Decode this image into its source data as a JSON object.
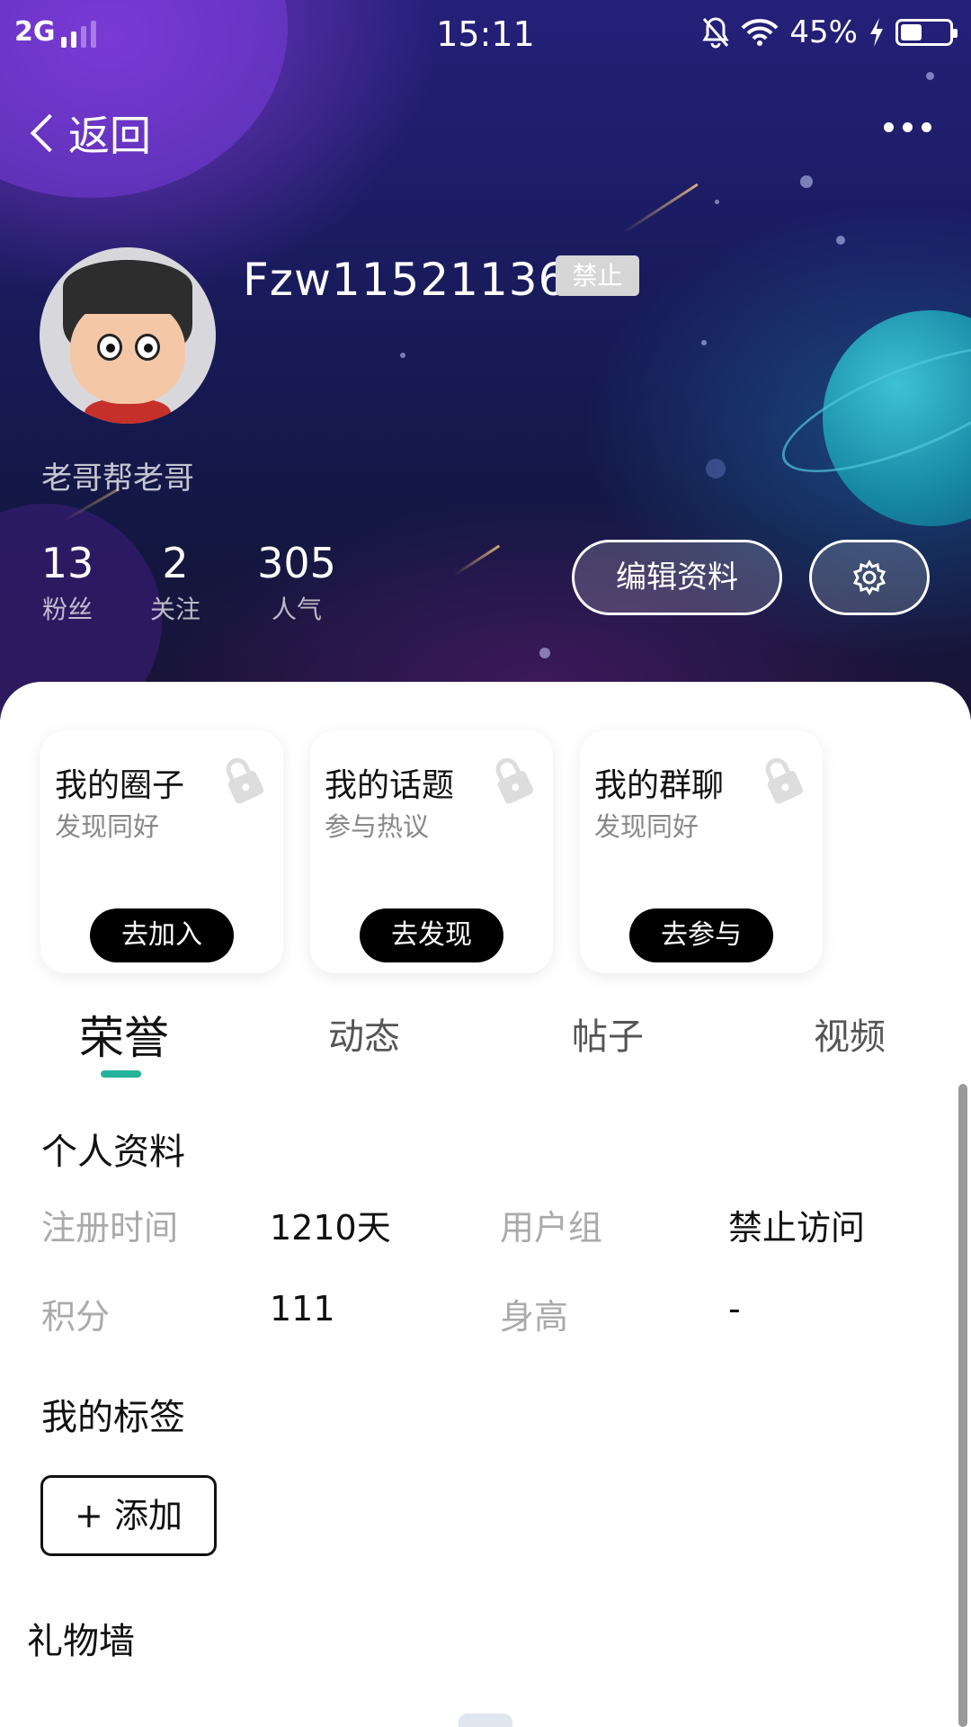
{
  "status_bar": {
    "network": "2G",
    "time": "15:11",
    "battery_text": "45%",
    "battery_level": 0.45
  },
  "nav": {
    "back_label": "返回"
  },
  "profile": {
    "username": "Fzw115211369",
    "badge": "禁止",
    "nickname": "老哥帮老哥",
    "stats": [
      {
        "value": "13",
        "label": "粉丝"
      },
      {
        "value": "2",
        "label": "关注"
      },
      {
        "value": "305",
        "label": "人气"
      }
    ],
    "edit_button": "编辑资料"
  },
  "cards": [
    {
      "title": "我的圈子",
      "subtitle": "发现同好",
      "button": "去加入"
    },
    {
      "title": "我的话题",
      "subtitle": "参与热议",
      "button": "去发现"
    },
    {
      "title": "我的群聊",
      "subtitle": "发现同好",
      "button": "去参与"
    }
  ],
  "tabs": [
    {
      "label": "荣誉"
    },
    {
      "label": "动态"
    },
    {
      "label": "帖子"
    },
    {
      "label": "视频"
    }
  ],
  "personal": {
    "title": "个人资料",
    "rows": [
      {
        "label1": "注册时间",
        "value1": "1210天",
        "label2": "用户组",
        "value2": "禁止访问"
      },
      {
        "label1": "积分",
        "value1": "111",
        "label2": "身高",
        "value2": "-"
      }
    ]
  },
  "tags": {
    "title": "我的标签",
    "add_button": "+ 添加"
  },
  "gift_wall": {
    "title": "礼物墙"
  },
  "colors": {
    "accent": "#22b39a",
    "hero_dark": "#191b5c",
    "button_black": "#000000"
  }
}
